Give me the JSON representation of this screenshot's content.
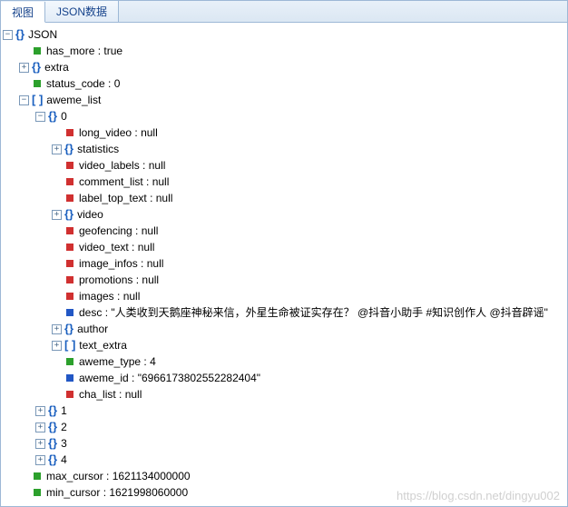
{
  "tabs": {
    "active": "视图",
    "inactive": "JSON数据"
  },
  "tree": {
    "root": "JSON",
    "has_more": {
      "k": "has_more",
      "v": "true"
    },
    "extra": "extra",
    "status_code": {
      "k": "status_code",
      "v": "0"
    },
    "aweme_list": "aweme_list",
    "item0": {
      "label": "0",
      "long_video": {
        "k": "long_video",
        "v": "null"
      },
      "statistics": "statistics",
      "video_labels": {
        "k": "video_labels",
        "v": "null"
      },
      "comment_list": {
        "k": "comment_list",
        "v": "null"
      },
      "label_top_text": {
        "k": "label_top_text",
        "v": "null"
      },
      "video": "video",
      "geofencing": {
        "k": "geofencing",
        "v": "null"
      },
      "video_text": {
        "k": "video_text",
        "v": "null"
      },
      "image_infos": {
        "k": "image_infos",
        "v": "null"
      },
      "promotions": {
        "k": "promotions",
        "v": "null"
      },
      "images": {
        "k": "images",
        "v": "null"
      },
      "desc": {
        "k": "desc",
        "v": "\"人类收到天鹅座神秘来信，外星生命被证实存在？ @抖音小助手 #知识创作人 @抖音辟谣\""
      },
      "author": "author",
      "text_extra": "text_extra",
      "aweme_type": {
        "k": "aweme_type",
        "v": "4"
      },
      "aweme_id": {
        "k": "aweme_id",
        "v": "\"6966173802552282404\""
      },
      "cha_list": {
        "k": "cha_list",
        "v": "null"
      }
    },
    "item1": "1",
    "item2": "2",
    "item3": "3",
    "item4": "4",
    "max_cursor": {
      "k": "max_cursor",
      "v": "1621134000000"
    },
    "min_cursor": {
      "k": "min_cursor",
      "v": "1621998060000"
    }
  },
  "watermark": "https://blog.csdn.net/dingyu002"
}
